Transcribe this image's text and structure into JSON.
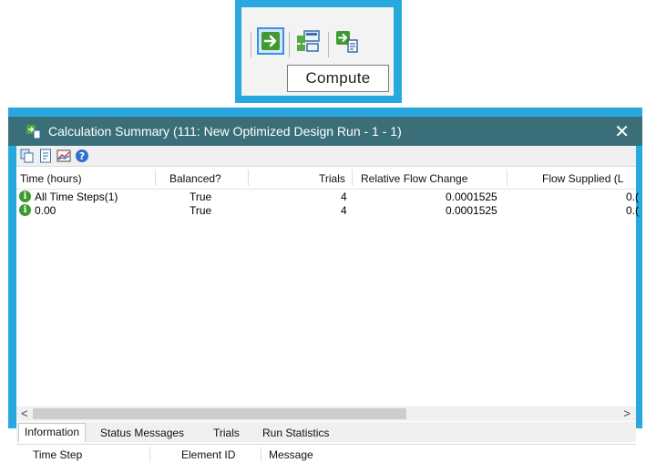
{
  "toolbar_callout": {
    "buttons": [
      {
        "icon": "compute-arrow-icon",
        "active": true
      },
      {
        "icon": "network-map-icon",
        "active": false
      },
      {
        "icon": "compute-report-icon",
        "active": false
      }
    ],
    "tooltip": "Compute"
  },
  "dialog": {
    "title": "Calculation Summary (111: New Optimized Design Run - 1 - 1)",
    "close_glyph": "✕",
    "toolbar_icons": [
      "copy-icon",
      "report-icon",
      "graph-icon",
      "help-icon"
    ],
    "columns": [
      "Time (hours)",
      "Balanced?",
      "Trials",
      "Relative Flow Change",
      "Flow Supplied (L"
    ],
    "rows": [
      {
        "time": "All Time Steps(1)",
        "balanced": "True",
        "trials": "4",
        "relative_flow_change": "0.0001525",
        "flow_supplied": "0.("
      },
      {
        "time": "0.00",
        "balanced": "True",
        "trials": "4",
        "relative_flow_change": "0.0001525",
        "flow_supplied": "0.("
      }
    ],
    "scroll_left": "<",
    "scroll_right": ">",
    "tabs": [
      "Information",
      "Status Messages",
      "Trials",
      "Run Statistics"
    ],
    "active_tab": "Information",
    "lower_columns": [
      "Time Step",
      "Element ID",
      "Message"
    ]
  },
  "colors": {
    "callout_border": "#29a8e0",
    "titlebar": "#3a6f7a",
    "status_icon": "#3b9a2e"
  }
}
